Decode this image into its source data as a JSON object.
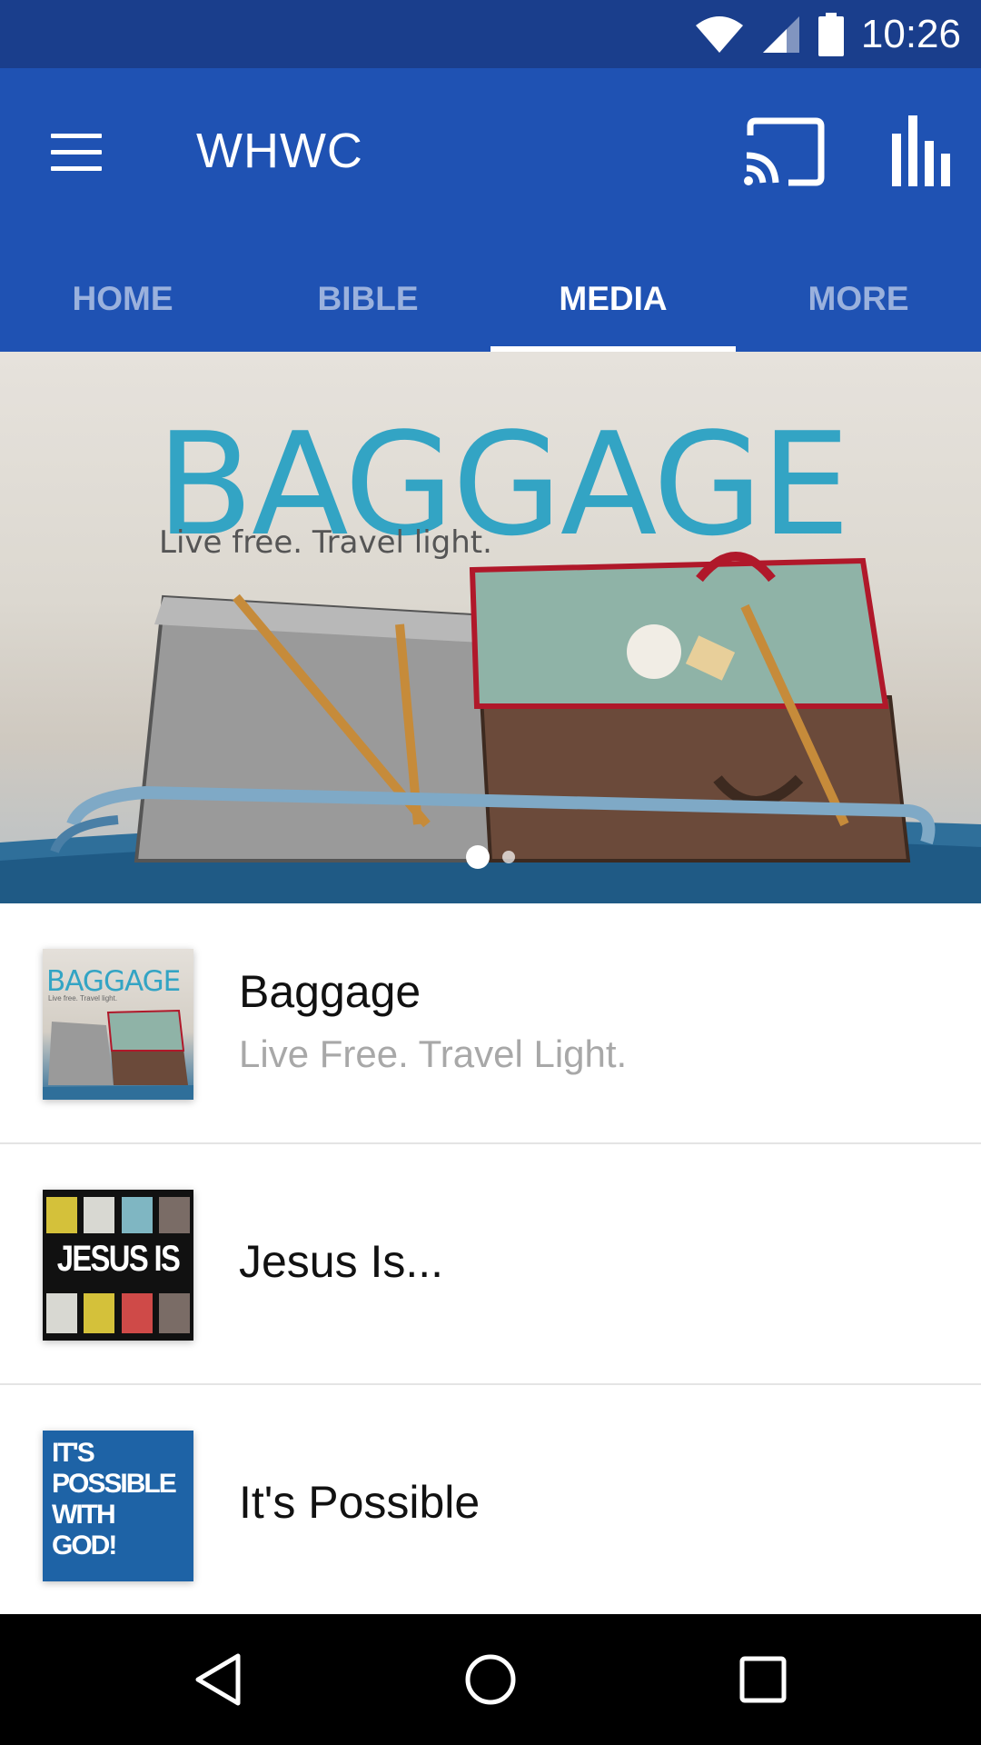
{
  "status_bar": {
    "time": "10:26",
    "icons": [
      "wifi-icon",
      "cell-signal-icon",
      "battery-icon"
    ]
  },
  "app_bar": {
    "title": "WHWC",
    "menu_icon": "menu-icon",
    "actions": [
      "cast-icon",
      "stats-icon"
    ]
  },
  "tabs": [
    {
      "label": "HOME",
      "active": false
    },
    {
      "label": "BIBLE",
      "active": false
    },
    {
      "label": "MEDIA",
      "active": true
    },
    {
      "label": "MORE",
      "active": false
    }
  ],
  "hero": {
    "title": "BAGGAGE",
    "tagline": "Live free. Travel light.",
    "page_count": 2,
    "current_page": 1
  },
  "series": [
    {
      "title": "Baggage",
      "subtitle": "Live Free.  Travel Light.",
      "thumb_text": "BAGGAGE",
      "thumb_subtext": "Live free. Travel light."
    },
    {
      "title": "Jesus Is...",
      "subtitle": "",
      "thumb_text": "JESUS IS"
    },
    {
      "title": "It's Possible",
      "subtitle": "",
      "thumb_lines": [
        "IT'S",
        "POSSIBLE",
        "WITH",
        "GOD!"
      ]
    }
  ],
  "nav_bar": {
    "buttons": [
      "back-icon",
      "home-icon",
      "recents-icon"
    ]
  },
  "colors": {
    "status_bar": "#1a3e8c",
    "app_bar": "#1f52b3",
    "hero_title": "#33a4c4",
    "subtitle": "#a8a8a8"
  }
}
